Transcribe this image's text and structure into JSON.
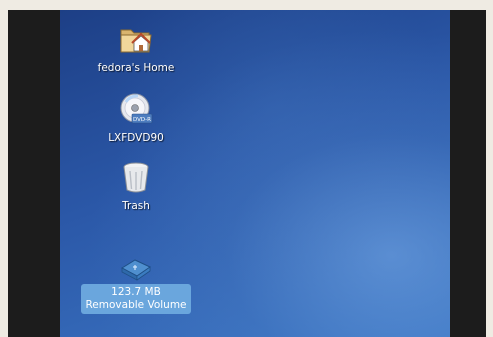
{
  "desktop": {
    "icons": [
      {
        "name": "home-folder-icon",
        "label": "fedora's Home"
      },
      {
        "name": "dvd-icon",
        "label": "LXFDVD90",
        "disc_text": "DVD-R"
      },
      {
        "name": "trash-icon",
        "label": "Trash"
      },
      {
        "name": "removable-drive-icon",
        "label_line1": "123.7 MB",
        "label_line2": "Removable Volume"
      }
    ]
  },
  "colors": {
    "desktop_blue": "#2b58a8",
    "selection": "#6aa6dd",
    "frame": "#1c1c1c"
  }
}
